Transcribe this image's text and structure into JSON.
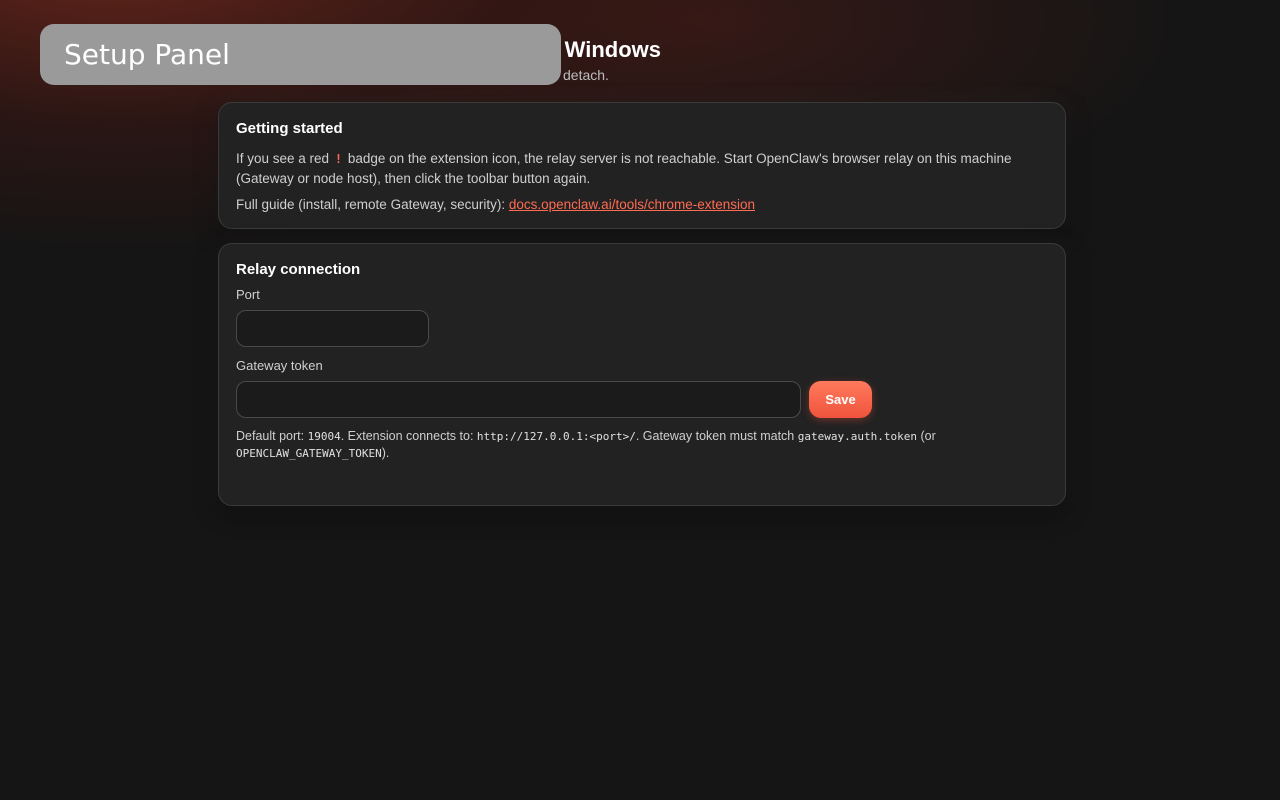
{
  "overlay": {
    "label": "Setup Panel"
  },
  "header": {
    "title": "r Windows",
    "subtitle": "detach."
  },
  "getting_started": {
    "title": "Getting started",
    "para1_before": "If you see a red",
    "badge_char": "!",
    "para1_after": "badge on the extension icon, the relay server is not reachable. Start OpenClaw's browser relay on this machine (Gateway or node host), then click the toolbar button again.",
    "guide_prefix": "Full guide (install, remote Gateway, security):",
    "guide_link": "docs.openclaw.ai/tools/chrome-extension"
  },
  "relay": {
    "title": "Relay connection",
    "port_label": "Port",
    "port_value": "",
    "token_label": "Gateway token",
    "token_value": "",
    "save_label": "Save",
    "help_1": "Default port:",
    "help_port": "19004",
    "help_2": ". Extension connects to:",
    "help_url": "http://127.0.0.1:<port>/",
    "help_3": ". Gateway token must match",
    "help_key": "gateway.auth.token",
    "help_4": "(or",
    "help_env": "OPENCLAW_GATEWAY_TOKEN",
    "help_5": ")."
  }
}
